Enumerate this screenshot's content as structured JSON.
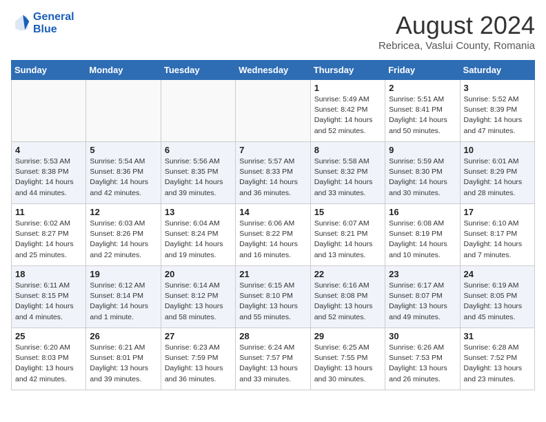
{
  "header": {
    "logo_line1": "General",
    "logo_line2": "Blue",
    "month": "August 2024",
    "location": "Rebricea, Vaslui County, Romania"
  },
  "weekdays": [
    "Sunday",
    "Monday",
    "Tuesday",
    "Wednesday",
    "Thursday",
    "Friday",
    "Saturday"
  ],
  "weeks": [
    [
      {
        "day": "",
        "info": ""
      },
      {
        "day": "",
        "info": ""
      },
      {
        "day": "",
        "info": ""
      },
      {
        "day": "",
        "info": ""
      },
      {
        "day": "1",
        "info": "Sunrise: 5:49 AM\nSunset: 8:42 PM\nDaylight: 14 hours\nand 52 minutes."
      },
      {
        "day": "2",
        "info": "Sunrise: 5:51 AM\nSunset: 8:41 PM\nDaylight: 14 hours\nand 50 minutes."
      },
      {
        "day": "3",
        "info": "Sunrise: 5:52 AM\nSunset: 8:39 PM\nDaylight: 14 hours\nand 47 minutes."
      }
    ],
    [
      {
        "day": "4",
        "info": "Sunrise: 5:53 AM\nSunset: 8:38 PM\nDaylight: 14 hours\nand 44 minutes."
      },
      {
        "day": "5",
        "info": "Sunrise: 5:54 AM\nSunset: 8:36 PM\nDaylight: 14 hours\nand 42 minutes."
      },
      {
        "day": "6",
        "info": "Sunrise: 5:56 AM\nSunset: 8:35 PM\nDaylight: 14 hours\nand 39 minutes."
      },
      {
        "day": "7",
        "info": "Sunrise: 5:57 AM\nSunset: 8:33 PM\nDaylight: 14 hours\nand 36 minutes."
      },
      {
        "day": "8",
        "info": "Sunrise: 5:58 AM\nSunset: 8:32 PM\nDaylight: 14 hours\nand 33 minutes."
      },
      {
        "day": "9",
        "info": "Sunrise: 5:59 AM\nSunset: 8:30 PM\nDaylight: 14 hours\nand 30 minutes."
      },
      {
        "day": "10",
        "info": "Sunrise: 6:01 AM\nSunset: 8:29 PM\nDaylight: 14 hours\nand 28 minutes."
      }
    ],
    [
      {
        "day": "11",
        "info": "Sunrise: 6:02 AM\nSunset: 8:27 PM\nDaylight: 14 hours\nand 25 minutes."
      },
      {
        "day": "12",
        "info": "Sunrise: 6:03 AM\nSunset: 8:26 PM\nDaylight: 14 hours\nand 22 minutes."
      },
      {
        "day": "13",
        "info": "Sunrise: 6:04 AM\nSunset: 8:24 PM\nDaylight: 14 hours\nand 19 minutes."
      },
      {
        "day": "14",
        "info": "Sunrise: 6:06 AM\nSunset: 8:22 PM\nDaylight: 14 hours\nand 16 minutes."
      },
      {
        "day": "15",
        "info": "Sunrise: 6:07 AM\nSunset: 8:21 PM\nDaylight: 14 hours\nand 13 minutes."
      },
      {
        "day": "16",
        "info": "Sunrise: 6:08 AM\nSunset: 8:19 PM\nDaylight: 14 hours\nand 10 minutes."
      },
      {
        "day": "17",
        "info": "Sunrise: 6:10 AM\nSunset: 8:17 PM\nDaylight: 14 hours\nand 7 minutes."
      }
    ],
    [
      {
        "day": "18",
        "info": "Sunrise: 6:11 AM\nSunset: 8:15 PM\nDaylight: 14 hours\nand 4 minutes."
      },
      {
        "day": "19",
        "info": "Sunrise: 6:12 AM\nSunset: 8:14 PM\nDaylight: 14 hours\nand 1 minute."
      },
      {
        "day": "20",
        "info": "Sunrise: 6:14 AM\nSunset: 8:12 PM\nDaylight: 13 hours\nand 58 minutes."
      },
      {
        "day": "21",
        "info": "Sunrise: 6:15 AM\nSunset: 8:10 PM\nDaylight: 13 hours\nand 55 minutes."
      },
      {
        "day": "22",
        "info": "Sunrise: 6:16 AM\nSunset: 8:08 PM\nDaylight: 13 hours\nand 52 minutes."
      },
      {
        "day": "23",
        "info": "Sunrise: 6:17 AM\nSunset: 8:07 PM\nDaylight: 13 hours\nand 49 minutes."
      },
      {
        "day": "24",
        "info": "Sunrise: 6:19 AM\nSunset: 8:05 PM\nDaylight: 13 hours\nand 45 minutes."
      }
    ],
    [
      {
        "day": "25",
        "info": "Sunrise: 6:20 AM\nSunset: 8:03 PM\nDaylight: 13 hours\nand 42 minutes."
      },
      {
        "day": "26",
        "info": "Sunrise: 6:21 AM\nSunset: 8:01 PM\nDaylight: 13 hours\nand 39 minutes."
      },
      {
        "day": "27",
        "info": "Sunrise: 6:23 AM\nSunset: 7:59 PM\nDaylight: 13 hours\nand 36 minutes."
      },
      {
        "day": "28",
        "info": "Sunrise: 6:24 AM\nSunset: 7:57 PM\nDaylight: 13 hours\nand 33 minutes."
      },
      {
        "day": "29",
        "info": "Sunrise: 6:25 AM\nSunset: 7:55 PM\nDaylight: 13 hours\nand 30 minutes."
      },
      {
        "day": "30",
        "info": "Sunrise: 6:26 AM\nSunset: 7:53 PM\nDaylight: 13 hours\nand 26 minutes."
      },
      {
        "day": "31",
        "info": "Sunrise: 6:28 AM\nSunset: 7:52 PM\nDaylight: 13 hours\nand 23 minutes."
      }
    ]
  ]
}
